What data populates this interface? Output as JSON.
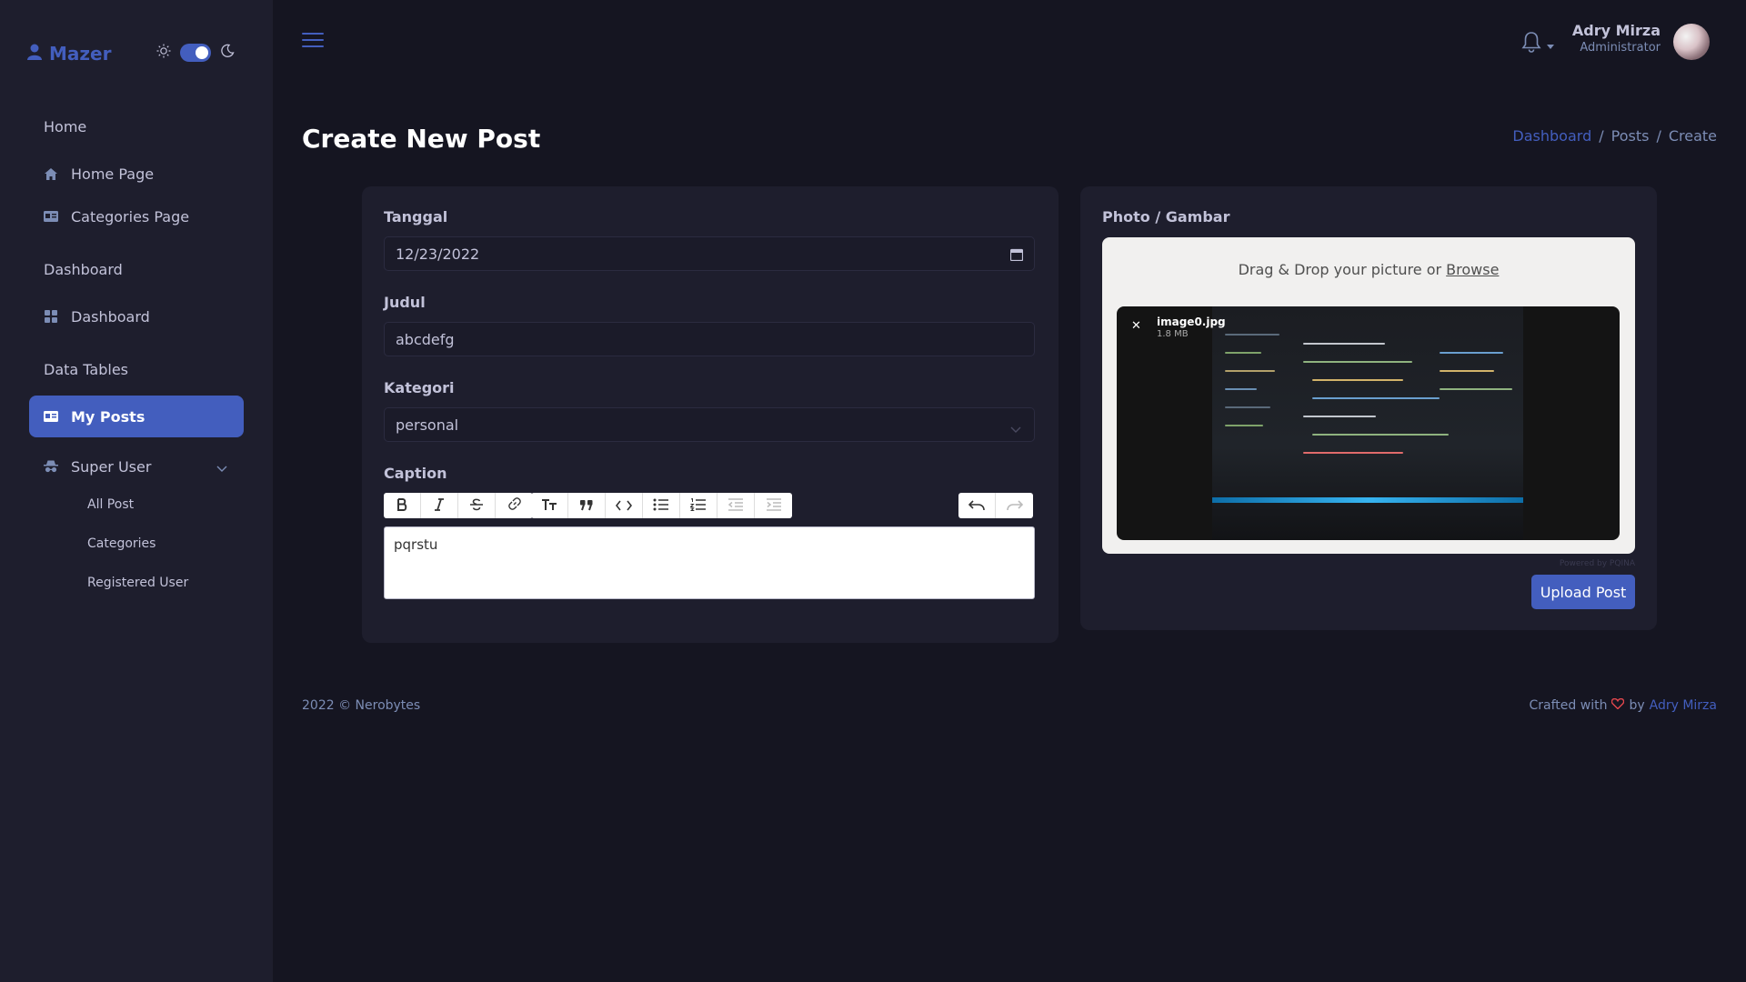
{
  "brand": {
    "name": "Mazer"
  },
  "sidebar": {
    "sections": [
      {
        "title": "Home"
      },
      {
        "title": "Dashboard"
      },
      {
        "title": "Data Tables"
      }
    ],
    "items": [
      {
        "label": "Home Page",
        "icon": "house-icon"
      },
      {
        "label": "Categories Page",
        "icon": "card-icon"
      },
      {
        "label": "Dashboard",
        "icon": "grid-icon"
      },
      {
        "label": "My Posts",
        "icon": "card-icon"
      },
      {
        "label": "Super User",
        "icon": "incognito-icon"
      }
    ],
    "submenu": [
      "All Post",
      "Categories",
      "Registered User"
    ]
  },
  "header": {
    "user_name": "Adry Mirza",
    "user_role": "Administrator"
  },
  "page": {
    "title": "Create New Post",
    "breadcrumb": [
      "Dashboard",
      "Posts",
      "Create"
    ]
  },
  "form": {
    "tanggal_label": "Tanggal",
    "tanggal_value": "12/23/2022",
    "judul_label": "Judul",
    "judul_value": "abcdefg",
    "kategori_label": "Kategori",
    "kategori_value": "personal",
    "caption_label": "Caption",
    "caption_value": "pqrstu"
  },
  "photo": {
    "label": "Photo / Gambar",
    "drop_text": "Drag & Drop your picture or",
    "browse": "Browse",
    "file_name": "image0.jpg",
    "file_size": "1.8 MB",
    "powered": "Powered by PQINA",
    "upload_label": "Upload Post"
  },
  "footer": {
    "left": "2022 © Nerobytes",
    "crafted": "Crafted with",
    "by": "by",
    "author": "Adry Mirza"
  },
  "colors": {
    "accent": "#435ebe",
    "background": "#151521",
    "sidebar": "#1e1e2d",
    "heart": "#e3474d"
  }
}
